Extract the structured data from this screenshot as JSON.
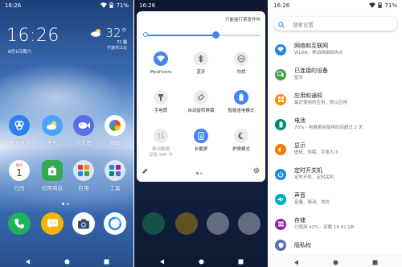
{
  "screen1": {
    "status": {
      "time": "16:26",
      "battery": "71%"
    },
    "clock": "16:26",
    "date": "8月1日周六",
    "weather": {
      "temp": "32°",
      "range": "72 霾",
      "location": "宁波市江北"
    },
    "apps": [
      {
        "label": "极速问诊",
        "color": "#2f80ed",
        "icon": "medical-icon"
      },
      {
        "label": "天气",
        "color": "#4aa3ff",
        "icon": "weather-icon"
      },
      {
        "label": "小京鱼",
        "color": "#5b6fe0",
        "icon": "fish-icon"
      },
      {
        "label": "图库",
        "color": "#ffffff",
        "icon": "gallery-icon"
      },
      {
        "label": "日历",
        "color": "#ffffff",
        "icon": "calendar-icon",
        "day": "1",
        "weekday": "周六"
      },
      {
        "label": "应用商店",
        "color": "#34a853",
        "icon": "store-icon"
      },
      {
        "label": "应用",
        "color": "#e6ecf5",
        "icon": "apps-folder-icon"
      },
      {
        "label": "工具",
        "color": "#e6ecf5",
        "icon": "tools-folder-icon"
      }
    ],
    "dock": [
      {
        "name": "phone-app",
        "color": "#1fb15a",
        "icon": "phone-icon"
      },
      {
        "name": "messages-app",
        "color": "#f5b400",
        "icon": "message-icon"
      },
      {
        "name": "camera-app",
        "color": "#ffffff",
        "icon": "camera-icon"
      },
      {
        "name": "browser-app",
        "color": "#ffffff",
        "icon": "browser-icon"
      }
    ]
  },
  "screen2": {
    "status": {
      "time": "16:26"
    },
    "shortcut_label": "只能接打紧急呼叫",
    "brightness": 0.6,
    "tiles": [
      {
        "label": "Mydrivers",
        "on": true,
        "icon": "wifi-icon"
      },
      {
        "label": "蓝牙",
        "on": false,
        "icon": "bluetooth-icon"
      },
      {
        "label": "勿扰",
        "on": false,
        "icon": "do-not-disturb-icon"
      },
      {
        "label": "手电筒",
        "on": false,
        "icon": "flashlight-icon"
      },
      {
        "label": "自动旋转屏幕",
        "on": false,
        "icon": "auto-rotate-icon"
      },
      {
        "label": "智能省电模式",
        "on": true,
        "icon": "battery-saver-icon"
      },
      {
        "label": "移动数据\n没有 SIM 卡",
        "on": false,
        "dim": true,
        "icon": "mobile-data-icon"
      },
      {
        "label": "长截屏",
        "on": true,
        "icon": "long-screenshot-icon"
      },
      {
        "label": "护眼模式",
        "on": false,
        "icon": "eye-comfort-icon"
      }
    ]
  },
  "screen3": {
    "status": {
      "time": "16:26",
      "battery": "71%"
    },
    "search_placeholder": "搜索设置",
    "items": [
      {
        "title": "网络和互联网",
        "subtitle": "WLAN、移动网络和热点",
        "color": "#1e88e5",
        "icon": "wifi-icon"
      },
      {
        "title": "已连接的设备",
        "subtitle": "蓝牙",
        "color": "#43a047",
        "icon": "connected-devices-icon"
      },
      {
        "title": "应用和通知",
        "subtitle": "最近使用的应用、默认应用",
        "color": "#fb8c00",
        "icon": "apps-icon"
      },
      {
        "title": "电池",
        "subtitle": "70% - 电量剩余使用时间超过 2 天",
        "color": "#00897b",
        "icon": "battery-icon"
      },
      {
        "title": "显示",
        "subtitle": "壁纸、休眠、字体大小",
        "color": "#f57c00",
        "icon": "display-icon"
      },
      {
        "title": "定时开关机",
        "subtitle": "定时开机、定时关机",
        "color": "#1e88e5",
        "icon": "power-schedule-icon"
      },
      {
        "title": "声音",
        "subtitle": "音量、振动、勿扰",
        "color": "#00acc1",
        "icon": "sound-icon"
      },
      {
        "title": "存储",
        "subtitle": "已使用 42% - 还剩 18.62 GB",
        "color": "#8e24aa",
        "icon": "storage-icon"
      },
      {
        "title": "隐私权",
        "subtitle": "",
        "color": "#5c6bc0",
        "icon": "privacy-icon"
      }
    ]
  }
}
